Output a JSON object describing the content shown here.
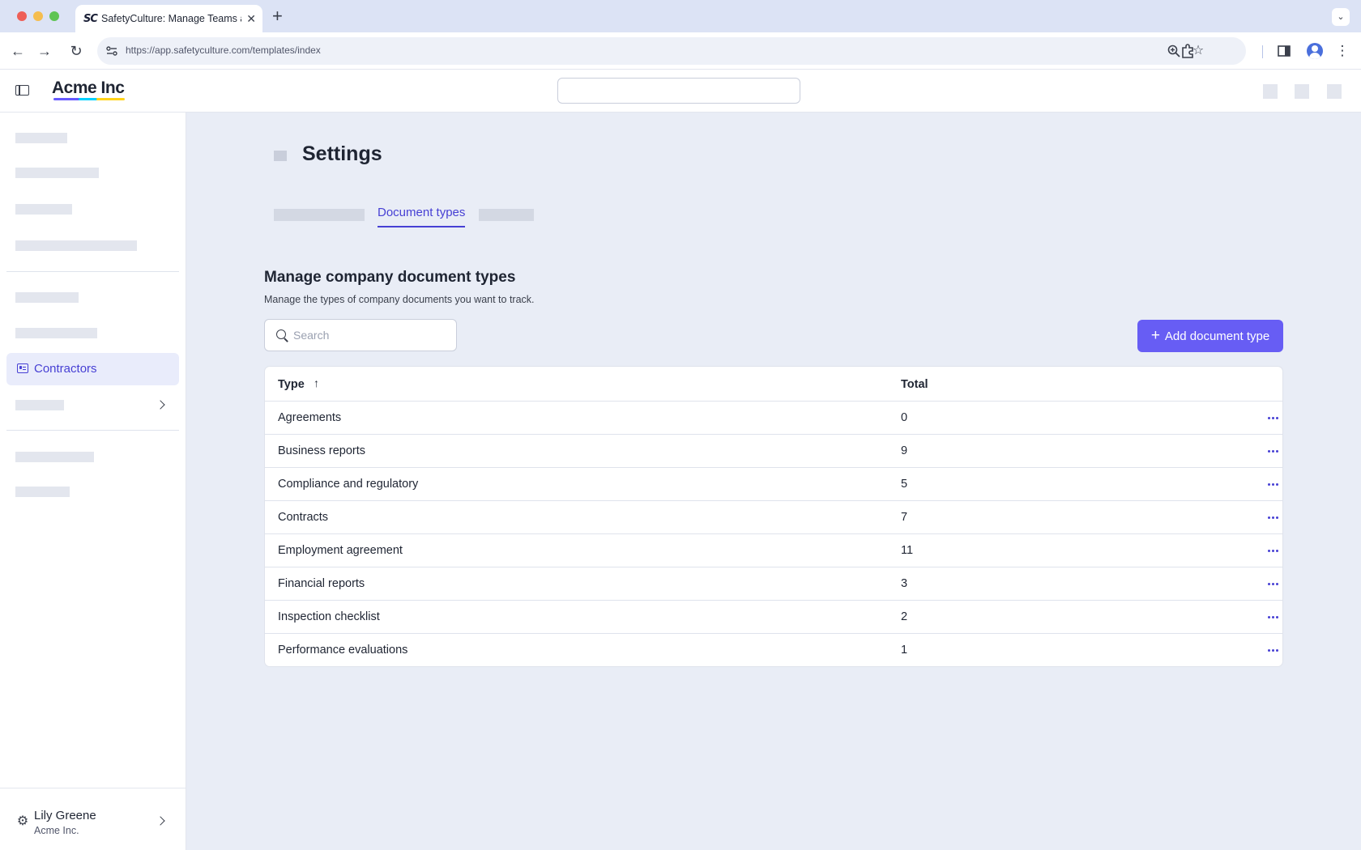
{
  "browser": {
    "tab_title": "SafetyCulture: Manage Teams and...",
    "favicon_text": "SC",
    "url": "https://app.safetyculture.com/templates/index"
  },
  "app": {
    "logo": "Acme Inc",
    "brand_color": "#675df4",
    "accent_color": "#4740d4"
  },
  "sidebar": {
    "active_item": {
      "label": "Contractors",
      "icon": "id-card-icon"
    },
    "user": {
      "name": "Lily Greene",
      "org": "Acme Inc."
    }
  },
  "main": {
    "page_title": "Settings",
    "active_tab": "Document types",
    "section_title": "Manage company document types",
    "section_description": "Manage the types of company documents you want to track.",
    "search_placeholder": "Search",
    "add_button": "Add document type",
    "table": {
      "col_type": "Type",
      "col_total": "Total",
      "sort": "ascending",
      "rows": [
        {
          "type": "Agreements",
          "total": "0"
        },
        {
          "type": "Business reports",
          "total": "9"
        },
        {
          "type": "Compliance and regulatory",
          "total": "5"
        },
        {
          "type": "Contracts",
          "total": "7"
        },
        {
          "type": "Employment agreement",
          "total": "11"
        },
        {
          "type": "Financial reports",
          "total": "3"
        },
        {
          "type": "Inspection checklist",
          "total": "2"
        },
        {
          "type": "Performance evaluations",
          "total": "1"
        }
      ]
    }
  }
}
